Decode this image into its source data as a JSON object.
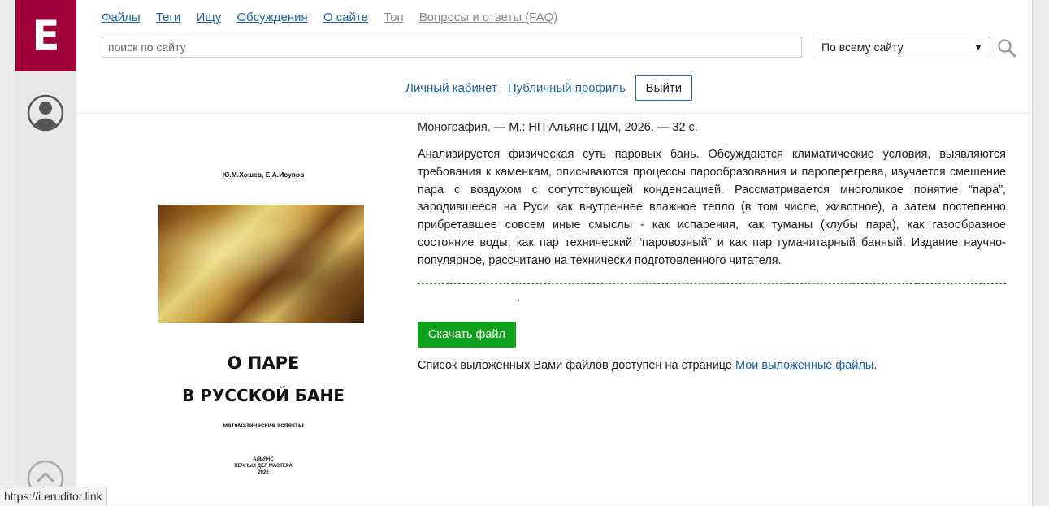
{
  "logo": {
    "letter": "E"
  },
  "nav": {
    "links": [
      "Файлы",
      "Теги",
      "Ищу",
      "Обсуждения",
      "О сайте"
    ],
    "muted_links": [
      "Топ",
      "Вопросы и ответы (FAQ)"
    ]
  },
  "search": {
    "placeholder": "поиск по сайту",
    "scope": "По всему сайту"
  },
  "account": {
    "cabinet": "Личный кабинет",
    "profile": "Публичный профиль",
    "logout": "Выйти"
  },
  "book": {
    "cover": {
      "authors": "Ю.М.Хошев, Е.А.Исупов",
      "title_line1": "О ПАРЕ",
      "title_line2": "В РУССКОЙ БАНЕ",
      "subtitle": "математические аспекты",
      "publisher_line1": "АЛЬЯНС",
      "publisher_line2": "ПЕЧНЫХ ДЕЛ МАСТЕРА",
      "year": "2026"
    },
    "biblio": "Монография. — М.: НП Альянс ПДМ, 2026. — 32 с.",
    "annotation": "Анализируется физическая суть паровых бань. Обсуждаются климатические условия, выявляются требования к каменкам, описываются процессы парообразования и пароперегрева, изучается смешение пара с воздухом с сопутствующей конденсацией. Рассматривается многоликое понятие “пара”, зародившееся на Руси как внутреннее влажное тепло (в том числе, животное), а затем постепенно прибретавшее совсем иные смыслы - как испарения, как туманы (клубы пара), как газообразное состояние воды, как пар технический “паровозный” и как пар гуманитарный банный. Издание научно-популярное, рассчитано на технически подготовленного читателя."
  },
  "download": {
    "button": "Скачать файл",
    "note": "Список выложенных Вами файлов доступен на странице ",
    "link": "Мои выложенные файлы",
    "after": "."
  },
  "status_url": "https://i.eruditor.link"
}
